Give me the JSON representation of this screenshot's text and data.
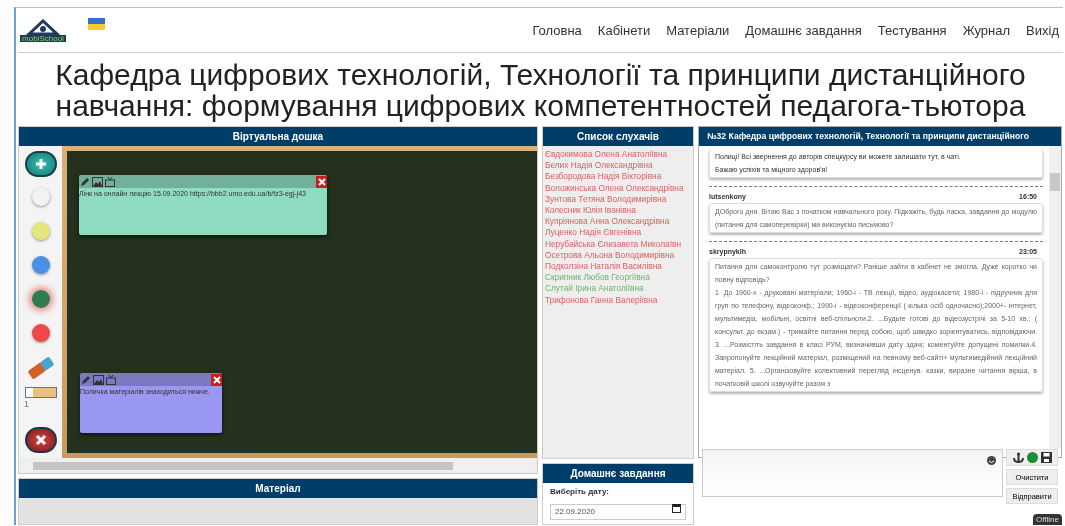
{
  "logo": {
    "text": "mobiSchool"
  },
  "nav": [
    {
      "label": "Головна"
    },
    {
      "label": "Кабінети"
    },
    {
      "label": "Матеріали"
    },
    {
      "label": "Домашнє завдання"
    },
    {
      "label": "Тестування"
    },
    {
      "label": "Журнал"
    },
    {
      "label": "Вихід"
    }
  ],
  "title": "Кафедра цифрових технологій, Технології та принципи дистанційного навчання: формування цифрових компетентностей педагога-тьютора",
  "board": {
    "title": "Віртуальна дошка",
    "colors": [
      {
        "color": "#f2f2f2",
        "selected": false
      },
      {
        "color": "#e6e67a",
        "selected": false
      },
      {
        "color": "#4a90e8",
        "selected": false
      },
      {
        "color": "#2e7d4f",
        "selected": true
      },
      {
        "color": "#f04848",
        "selected": false
      }
    ],
    "brush": {
      "level": 0.25,
      "reading": "1"
    },
    "notes": [
      {
        "color": "#8fdcc0",
        "text": "Лінк на онлайн лекцію 15.09.2020 https://bbb2.umo.edu.ua/b/fz3-egj-j43"
      },
      {
        "color": "#9a98f0",
        "text": "Поличка матеріалів знаходиться нижче."
      }
    ]
  },
  "material": {
    "title": "Матеріал"
  },
  "students": {
    "title": "Список слухачів",
    "items": [
      {
        "name": "Євдокимова Олена Анатоліївна",
        "online": false
      },
      {
        "name": "Белих Надія Олександрівна",
        "online": false
      },
      {
        "name": "Безбородова Надія Вікторівна",
        "online": false
      },
      {
        "name": "Воложинська Олена Олександрівна",
        "online": false
      },
      {
        "name": "Зунтова Тетяна Володимирівна",
        "online": false
      },
      {
        "name": "Колесник Юлія Іванівна",
        "online": false
      },
      {
        "name": "Купріянова Анна Олександрівна",
        "online": false
      },
      {
        "name": "Луценко Надія Євгенівна",
        "online": false
      },
      {
        "name": "Нерубайська Єлизавета Миколаївн",
        "online": false
      },
      {
        "name": "Осетрова Альона Володимирівна",
        "online": false
      },
      {
        "name": "Подколзіна Наталія Василівна",
        "online": false
      },
      {
        "name": "Скрипник Любов Георгіївна",
        "online": true
      },
      {
        "name": "Слутай Ірина Анатоліївна",
        "online": true
      },
      {
        "name": "Трифонова Ганна Валеріївна",
        "online": false
      }
    ]
  },
  "homework": {
    "title": "Домашнє завдання",
    "label": "Виберіть дату:",
    "date": "22.09.2020"
  },
  "chat": {
    "title": "№32 Кафедра цифрових технологій, Технології та принципи дистанційного",
    "messages": [
      {
        "lines": [
          "Полиці! Всі звернення до авторів спецкурсу ви можете залишати тут, в чаті.",
          "Бажаю успіхів та міцного здоров'я!"
        ]
      },
      {
        "author": "lutsenkony",
        "time": "16:50",
        "lines": [
          "ДОброго дня. Вітаю Вас з початком навчального року. Підкажіть, будь ласка, завдання до модулю (питання для самоперевірки) ми виконуємо письмово?"
        ]
      },
      {
        "author": "skrypnyklh",
        "time": "23:05",
        "lines": [
          "Питання для самоконтролю тут розміщати? Раніше зайти в кабінет не змогла. Дуже коротко чи повну відповідь?",
          "1. До 1960-х - друковані матеріали; 1960-і - ТВ лекції, відео, аудіокасети; 1980-і - підручник для груп по телефону, відеоконф.; 1990-і - відеоконференції ( кілька осіб одночасно);2000+- інтернет, мультимедіа, мобільні, освітні веб-спільноти.2. ...Будьте готові до відеозустрічі за 5-10 хв.; ( консульт. до екзам.) - тримайте питання перед собою, щоб швидко зорієнтуватись, відповідаючи. 3. ...Розмістіть завдання в класі РУМ, визначивши дату здачі; коментуйте допущені помилки.4. Запропонуйте лекційний матеріал, розміщений на певному веб-сайті+ мультимедійний лекційний матеріал. 5. ...Організовуйте колективний перегляд інсценув. казки, виразне читання вірша, в початковій школі озвучуйте разом з"
        ]
      }
    ],
    "buttons": [
      "Очистити",
      "Відправити"
    ]
  },
  "status_badge": "Offline"
}
